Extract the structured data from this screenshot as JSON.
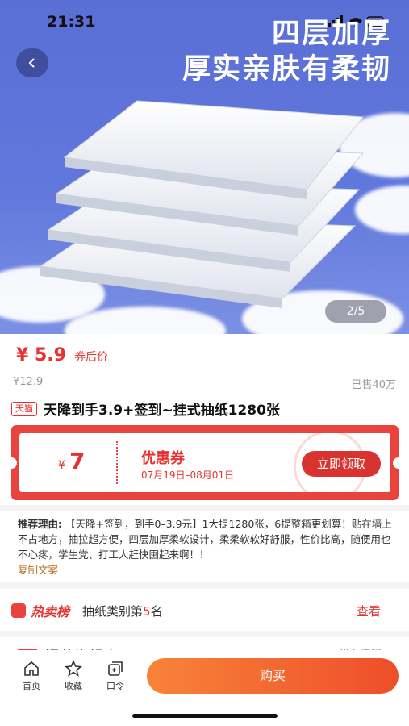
{
  "status": {
    "time": "21:31"
  },
  "hero": {
    "title_line1": "四层加厚",
    "title_line2": "厚实亲肤有柔韧",
    "pager": "2/5"
  },
  "price": {
    "current": "¥ 5.9",
    "label": "券后价",
    "original": "¥12.9",
    "sold": "已售40万"
  },
  "product": {
    "badge": "天猫",
    "title": "天降到手3.9+签到~挂式抽纸1280张"
  },
  "coupon": {
    "currency": "¥",
    "amount": "7",
    "name": "优惠券",
    "validity": "07月19日–08月01日",
    "button": "立即领取"
  },
  "recommend": {
    "label": "推荐理由:",
    "text": "【天降+签到，到手0–3.9元】1大提1280张，6提整箱更划算！贴在墙上不占地方，抽拉超方便，四层加厚柔软设计，柔柔软软好舒服，性价比高，随便用也不心疼，学生党、打工人赶快囤起来啊！！",
    "copy": "复制文案"
  },
  "rank": {
    "logo": "热卖榜",
    "prefix": "抽纸类别第",
    "number": "5",
    "suffix": "名",
    "view": "查看"
  },
  "shop_peek": {
    "name": "温莎旗舰店",
    "enter": "进入店铺 ›"
  },
  "bottom": {
    "tabs": [
      {
        "label": "首页",
        "icon": "home-icon"
      },
      {
        "label": "收藏",
        "icon": "star-icon"
      },
      {
        "label": "口令",
        "icon": "command-icon"
      }
    ],
    "buy": "购买"
  },
  "colors": {
    "accent": "#e8322f",
    "hero_bg": "#5a6fd6",
    "buy_start": "#f8833a",
    "buy_end": "#ee4e2a"
  }
}
